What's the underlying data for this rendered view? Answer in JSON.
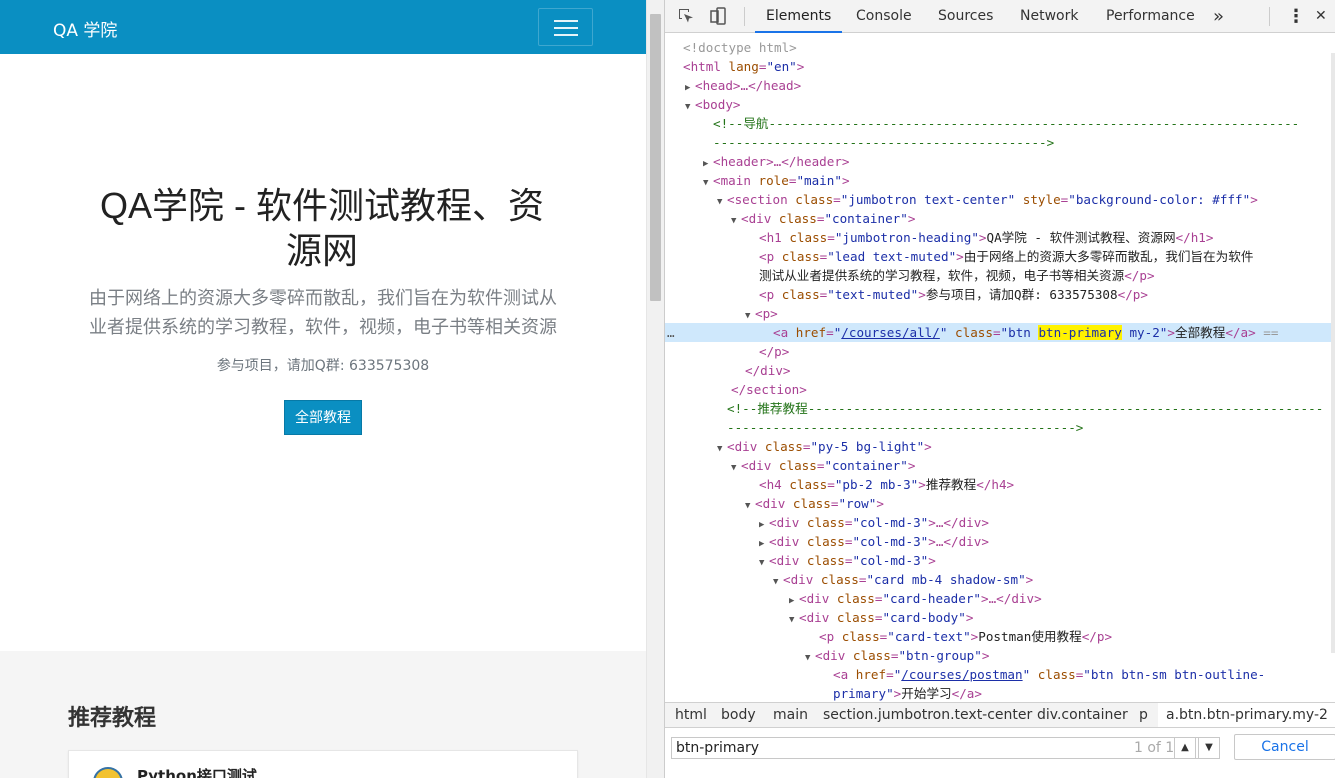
{
  "page": {
    "brand": "QA 学院",
    "jumbotron": {
      "heading_line1": "QA学院 - 软件测试教程、资",
      "heading_line2": "源网",
      "lead_line1": "由于网络上的资源大多零碎而散乱，我们旨在为软件测试从",
      "lead_line2": "业者提供系统的学习教程，软件，视频，电子书等相关资源",
      "join_text": "参与项目，请加Q群: 633575308",
      "all_courses_button": "全部教程"
    },
    "recommend": {
      "title": "推荐教程",
      "first_card_title": "Python接口测试"
    }
  },
  "devtools": {
    "tabs": [
      "Elements",
      "Console",
      "Sources",
      "Network",
      "Performance"
    ],
    "more_tabs": "»",
    "kebab": "⋮",
    "close": "✕",
    "dom": {
      "l0": {
        "text": "<!doctype html>"
      },
      "l1": {
        "open": "<html",
        "attr1": " lang",
        "val1": "\"en\"",
        "close": ">"
      },
      "l2": {
        "text": "<head>…</head>"
      },
      "l3": {
        "text": "<body>"
      },
      "l4": {
        "text": "<!--导航----------------------------------------------------------------------"
      },
      "l5": {
        "text": "-------------------------------------------->"
      },
      "l6": {
        "text": "<header>…</header>"
      },
      "l7": {
        "open": "<main",
        "attr1": " role",
        "val1": "\"main\"",
        "close": ">"
      },
      "l8": {
        "open": "<section",
        "attr1": " class",
        "val1": "\"jumbotron text-center\"",
        "attr2": " style",
        "val2": "\"background-color: #fff\"",
        "close": ">"
      },
      "l9": {
        "open": "<div",
        "attr1": " class",
        "val1": "\"container\"",
        "close": ">"
      },
      "l10": {
        "open": "<h1",
        "attr1": " class",
        "val1": "\"jumbotron-heading\"",
        "close": ">",
        "text": "QA学院 - 软件测试教程、资源网",
        "end": "</h1>"
      },
      "l11": {
        "open": "<p",
        "attr1": " class",
        "val1": "\"lead text-muted\"",
        "close": ">",
        "text": "由于网络上的资源大多零碎而散乱，我们旨在为软件"
      },
      "l12": {
        "text": "测试从业者提供系统的学习教程，软件，视频，电子书等相关资源",
        "end": "</p>"
      },
      "l13": {
        "open": "<p",
        "attr1": " class",
        "val1": "\"text-muted\"",
        "close": ">",
        "text": "参与项目，请加Q群: 633575308",
        "end": "</p>"
      },
      "l14": {
        "text": "<p>"
      },
      "l15": {
        "dots": "…",
        "open": "<a",
        "attr1": " href",
        "val1": "\"/courses/all/\"",
        "attr2": " class",
        "val2a": "\"btn ",
        "val2hl": "btn-primary",
        "val2b": " my-2\"",
        "close": ">",
        "text": "全部教程",
        "end": "</a>",
        "eq": " =="
      },
      "l16": {
        "text": "</p>"
      },
      "l17": {
        "text": "</div>"
      },
      "l18": {
        "text": "</section>"
      },
      "l19": {
        "text": "<!--推荐教程--------------------------------------------------------------------"
      },
      "l20": {
        "text": "---------------------------------------------->"
      },
      "l21": {
        "open": "<div",
        "attr1": " class",
        "val1": "\"py-5 bg-light\"",
        "close": ">"
      },
      "l22": {
        "open": "<div",
        "attr1": " class",
        "val1": "\"container\"",
        "close": ">"
      },
      "l23": {
        "open": "<h4",
        "attr1": " class",
        "val1": "\"pb-2 mb-3\"",
        "close": ">",
        "text": "推荐教程",
        "end": "</h4>"
      },
      "l24": {
        "open": "<div",
        "attr1": " class",
        "val1": "\"row\"",
        "close": ">"
      },
      "l25": {
        "open": "<div",
        "attr1": " class",
        "val1": "\"col-md-3\"",
        "close": ">…</div>"
      },
      "l26": {
        "open": "<div",
        "attr1": " class",
        "val1": "\"col-md-3\"",
        "close": ">…</div>"
      },
      "l27": {
        "open": "<div",
        "attr1": " class",
        "val1": "\"col-md-3\"",
        "close": ">"
      },
      "l28": {
        "open": "<div",
        "attr1": " class",
        "val1": "\"card mb-4 shadow-sm\"",
        "close": ">"
      },
      "l29": {
        "open": "<div",
        "attr1": " class",
        "val1": "\"card-header\"",
        "close": ">…</div>"
      },
      "l30": {
        "open": "<div",
        "attr1": " class",
        "val1": "\"card-body\"",
        "close": ">"
      },
      "l31": {
        "open": "<p",
        "attr1": " class",
        "val1": "\"card-text\"",
        "close": ">",
        "text": "Postman使用教程",
        "end": "</p>"
      },
      "l32": {
        "open": "<div",
        "attr1": " class",
        "val1": "\"btn-group\"",
        "close": ">"
      },
      "l33": {
        "open": "<a",
        "attr1": " href",
        "val1": "\"/courses/postman\"",
        "attr2": " class",
        "val2": "\"btn btn-sm btn-outline-"
      },
      "l34": {
        "text": "primary\"",
        "close": ">",
        "text2": "开始学习",
        "end": "</a>"
      }
    },
    "breadcrumbs": [
      "html",
      "body",
      "main",
      "section.jumbotron.text-center",
      "div.container",
      "p",
      "a.btn.btn-primary.my-2"
    ],
    "search": {
      "value": "btn-primary",
      "match_count": "1 of 1",
      "up": "▲",
      "down": "▼",
      "cancel": "Cancel"
    }
  }
}
